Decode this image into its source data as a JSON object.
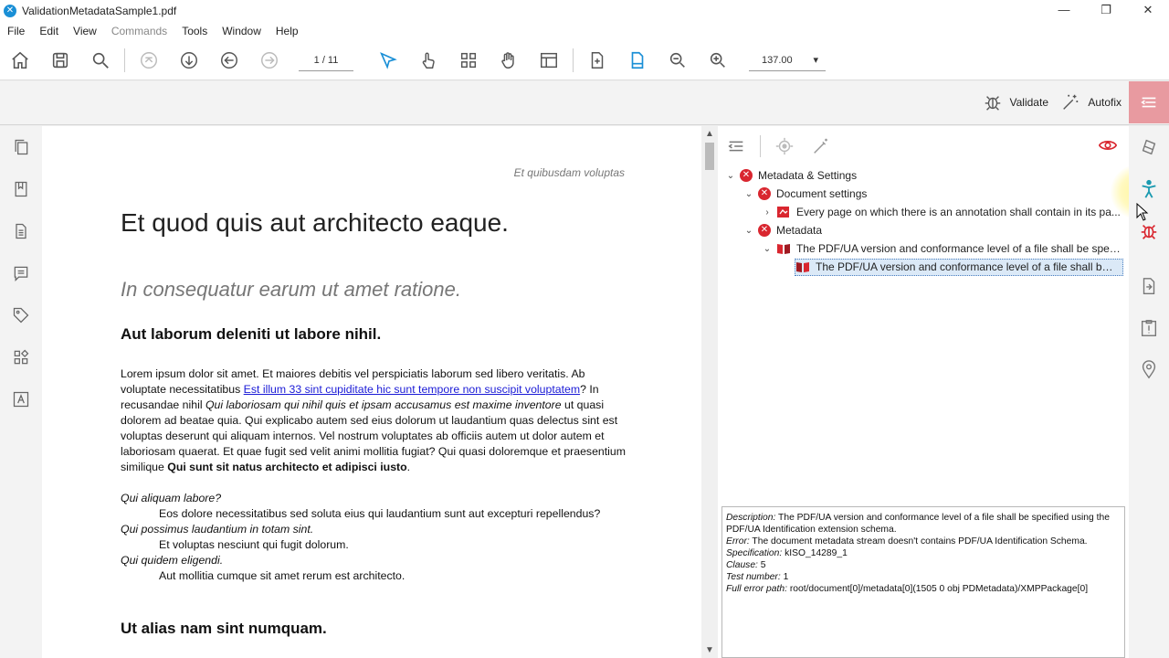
{
  "window": {
    "title": "ValidationMetadataSample1.pdf",
    "minimize": "—",
    "restore": "❐",
    "close": "✕"
  },
  "menu": [
    "File",
    "Edit",
    "View",
    "Commands",
    "Tools",
    "Window",
    "Help"
  ],
  "toolbar": {
    "page_indicator": "1 / 11",
    "zoom_value": "137.00"
  },
  "actions": {
    "validate_label": "Validate",
    "autofix_label": "Autofix"
  },
  "document": {
    "header": "Et quibusdam voluptas",
    "title": "Et quod quis aut architecto eaque.",
    "subtitle": "In consequatur earum ut amet ratione.",
    "heading1": "Aut laborum deleniti ut labore nihil.",
    "para_1": "Lorem ipsum dolor sit amet. Et maiores debitis vel perspiciatis laborum sed libero veritatis. Ab voluptate necessitatibus ",
    "para_link": "Est illum 33 sint cupiditate hic sunt tempore non suscipit voluptatem",
    "para_2": "? In recusandae nihil ",
    "para_italic": "Qui laboriosam qui nihil quis et ipsam accusamus est maxime inventore",
    "para_3": " ut quasi dolorem ad beatae quia. Qui explicabo autem sed eius dolorum ut laudantium quas delectus sint est voluptas deserunt qui aliquam internos. Vel nostrum voluptates ab officiis autem ut dolor autem et laboriosam quaerat. Et quae fugit sed velit animi mollitia fugiat? Qui quasi doloremque et praesentium similique ",
    "para_bold": "Qui sunt sit natus architecto et adipisci iusto",
    "para_end": ".",
    "qa": [
      {
        "q": "Qui aliquam labore?",
        "a": "Eos dolore necessitatibus sed soluta eius qui laudantium sunt aut excepturi repellendus?"
      },
      {
        "q": "Qui possimus laudantium in totam sint.",
        "a": "Et voluptas nesciunt qui fugit dolorum."
      },
      {
        "q": "Qui quidem eligendi.",
        "a": "Aut mollitia cumque sit amet rerum est architecto."
      }
    ],
    "heading2": "Ut alias nam sint numquam."
  },
  "tree": {
    "root": "Metadata & Settings",
    "doc_settings": "Document settings",
    "doc_settings_child": "Every page on which there is an annotation shall contain in its pa...",
    "metadata": "Metadata",
    "metadata_child": "The PDF/UA version and conformance level of a file shall be speci...",
    "metadata_grandchild": "The PDF/UA version and conformance level of a file shall be s..."
  },
  "details": {
    "description_label": "Description:",
    "description": " The PDF/UA version and conformance level of a file shall be specified using the PDF/UA Identification extension schema.",
    "error_label": "Error:",
    "error": " The document metadata stream doesn't contains PDF/UA Identification Schema.",
    "specification_label": "Specification:",
    "specification": " kISO_14289_1",
    "clause_label": "Clause:",
    "clause": " 5",
    "test_label": "Test number:",
    "test": " 1",
    "path_label": "Full error path:",
    "path": " root/document[0]/metadata[0](1505 0 obj PDMetadata)/XMPPackage[0]"
  },
  "colors": {
    "error_red": "#d9262f",
    "link_blue": "#1a1ad6",
    "panel_toggle": "#e89aa0",
    "accent_blue": "#1a8fd6"
  }
}
